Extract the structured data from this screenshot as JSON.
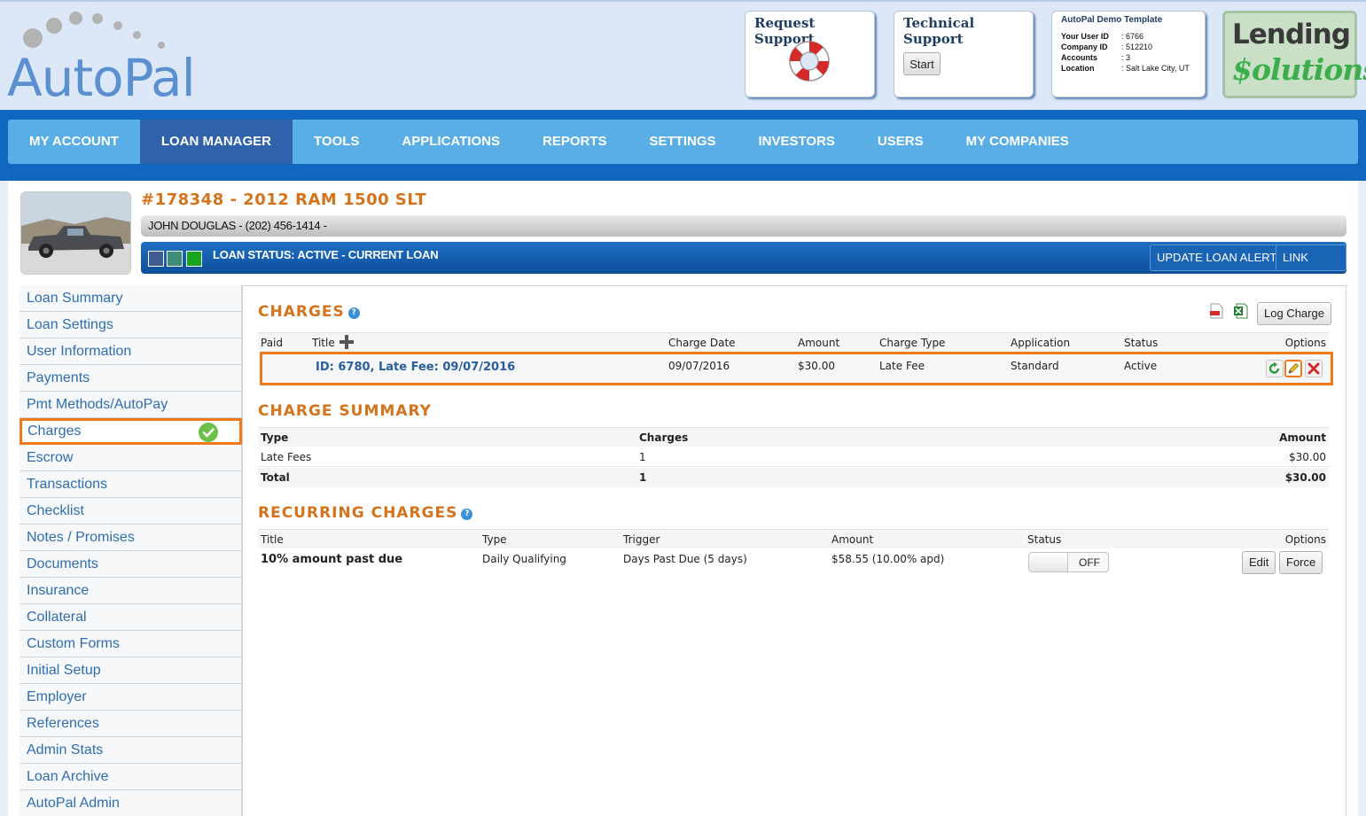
{
  "brand": {
    "logo_text": "AutoPal"
  },
  "header": {
    "request_support": "Request Support",
    "technical_support": "Technical Support",
    "start_label": "Start",
    "demo": {
      "title": "AutoPal Demo Template",
      "rows": [
        {
          "key": "Your User ID",
          "value": ": 6766"
        },
        {
          "key": "Company ID",
          "value": ": 512210"
        },
        {
          "key": "Accounts",
          "value": ": 3"
        },
        {
          "key": "Location",
          "value": ": Salt Lake City, UT"
        }
      ]
    },
    "lending_line1": "Lending",
    "lending_line2": "$olutions"
  },
  "nav": {
    "items": [
      "MY ACCOUNT",
      "LOAN MANAGER",
      "TOOLS",
      "APPLICATIONS",
      "REPORTS",
      "SETTINGS",
      "INVESTORS",
      "USERS",
      "MY COMPANIES"
    ],
    "active": "LOAN MANAGER"
  },
  "loan": {
    "title": "#178348 - 2012 RAM 1500 SLT",
    "borrower": "JOHN DOUGLAS - (202) 456-1414 -",
    "status": "LOAN STATUS: ACTIVE - CURRENT LOAN",
    "update_alert": "UPDATE LOAN ALERT",
    "link_loan": "LINK LOAN",
    "status_colors": [
      "#3f5b92",
      "#3d8c7a",
      "#16a51c"
    ]
  },
  "sidebar": {
    "items": [
      "Loan Summary",
      "Loan Settings",
      "User Information",
      "Payments",
      "Pmt Methods/AutoPay",
      "Charges",
      "Escrow",
      "Transactions",
      "Checklist",
      "Notes / Promises",
      "Documents",
      "Insurance",
      "Collateral",
      "Custom Forms",
      "Initial Setup",
      "Employer",
      "References",
      "Admin Stats",
      "Loan Archive",
      "AutoPal Admin"
    ],
    "active": "Charges"
  },
  "charges": {
    "title": "CHARGES",
    "log_charge": "Log Charge",
    "headers": {
      "paid": "Paid",
      "title": "Title",
      "charge_date": "Charge Date",
      "amount": "Amount",
      "charge_type": "Charge Type",
      "application": "Application",
      "status": "Status",
      "options": "Options"
    },
    "row": {
      "title": "ID: 6780, Late Fee: 09/07/2016",
      "charge_date": "09/07/2016",
      "amount": "$30.00",
      "charge_type": "Late Fee",
      "application": "Standard",
      "status": "Active"
    }
  },
  "summary": {
    "title": "CHARGE SUMMARY",
    "headers": {
      "type": "Type",
      "charges": "Charges",
      "amount": "Amount"
    },
    "rows": [
      {
        "type": "Late Fees",
        "charges": "1",
        "amount": "$30.00"
      },
      {
        "type": "Total",
        "charges": "1",
        "amount": "$30.00"
      }
    ]
  },
  "recurring": {
    "title": "RECURRING CHARGES",
    "headers": {
      "title": "Title",
      "type": "Type",
      "trigger": "Trigger",
      "amount": "Amount",
      "status": "Status",
      "options": "Options"
    },
    "row": {
      "title": "10% amount past due",
      "type": "Daily Qualifying",
      "trigger": "Days Past Due (5 days)",
      "amount": "$58.55 (10.00% apd)",
      "toggle": "OFF"
    },
    "edit": "Edit",
    "force": "Force"
  },
  "icons": {
    "help": "help-icon",
    "pdf": "pdf-icon",
    "excel": "excel-icon",
    "refresh": "refresh-icon",
    "edit": "pencil-icon",
    "delete": "delete-icon"
  }
}
